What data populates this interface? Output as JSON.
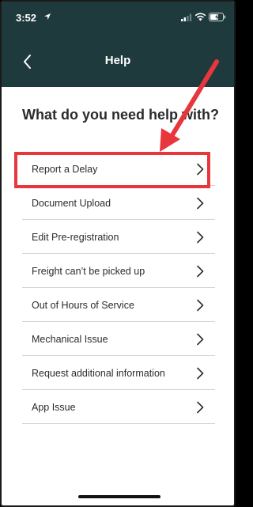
{
  "status_bar": {
    "time": "3:52"
  },
  "nav": {
    "title": "Help",
    "back_icon": "chevron-left-icon"
  },
  "heading": "What do you need help with?",
  "menu_items": [
    {
      "label": "Report a Delay"
    },
    {
      "label": "Document Upload"
    },
    {
      "label": "Edit Pre-registration"
    },
    {
      "label": "Freight can’t be picked up"
    },
    {
      "label": "Out of Hours of Service"
    },
    {
      "label": "Mechanical Issue"
    },
    {
      "label": "Request additional information"
    },
    {
      "label": "App Issue"
    }
  ],
  "colors": {
    "header_bg": "#1f3a3d",
    "highlight": "#e8363d",
    "arrow": "#e8363d"
  }
}
